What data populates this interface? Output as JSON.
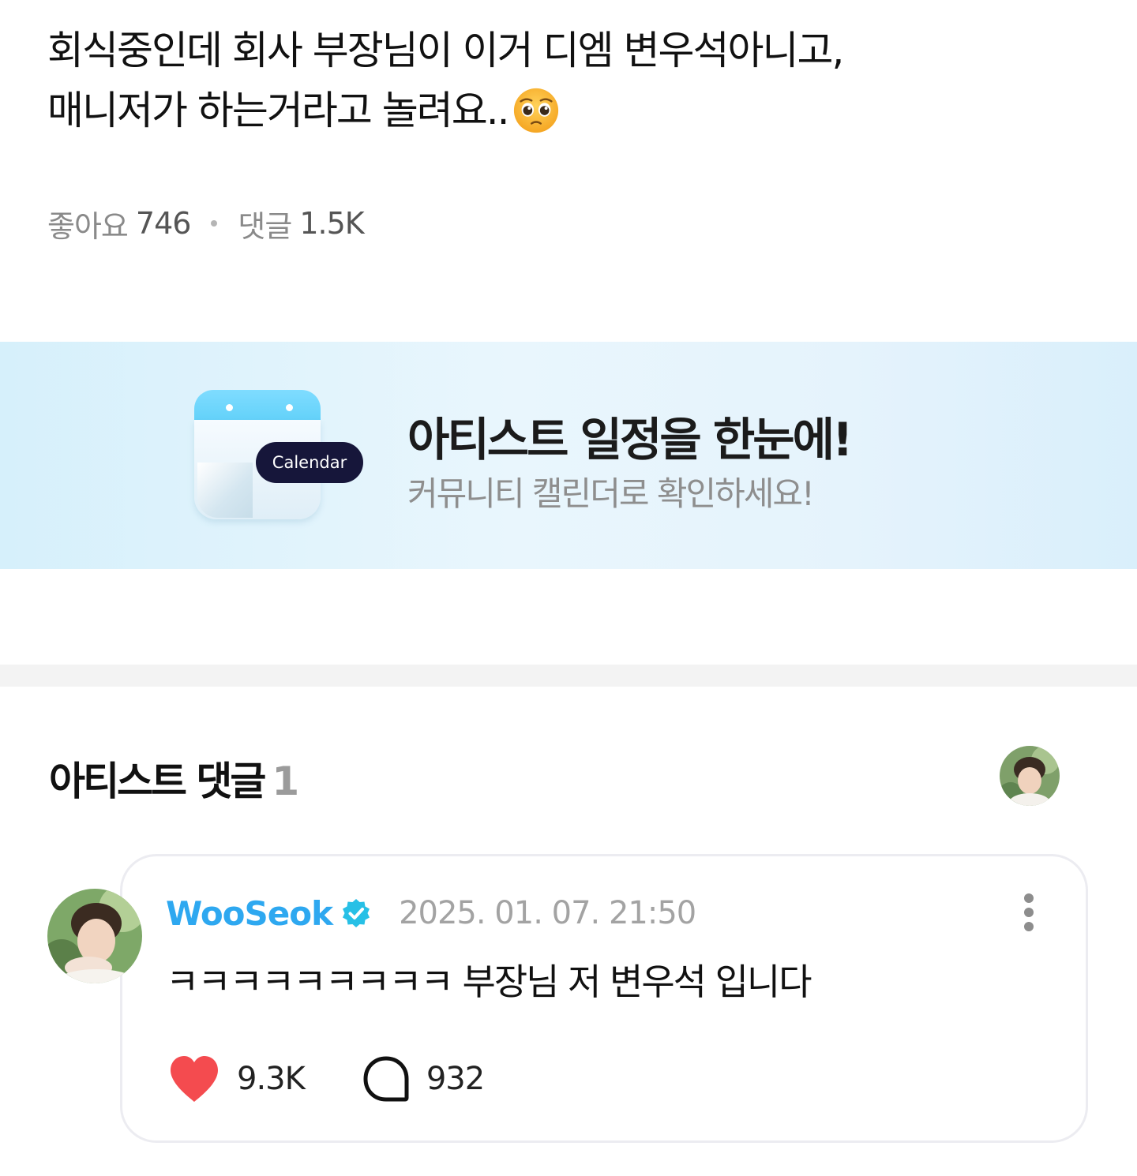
{
  "post": {
    "line1": "회식중인데 회사 부장님이 이거 디엠 변우석아니고,",
    "line2": "매니저가 하는거라고 놀려요..",
    "emoji": "pleading-face-emoji"
  },
  "stats": {
    "likes_label": "좋아요",
    "likes_count": "746",
    "comments_label": "댓글",
    "comments_count": "1.5K"
  },
  "banner": {
    "icon_label": "Calendar",
    "title": "아티스트 일정을 한눈에!",
    "subtitle": "커뮤니티 캘린더로 확인하세요!"
  },
  "artist_comments": {
    "title": "아티스트 댓글",
    "count": "1"
  },
  "comment": {
    "author": "WooSeok",
    "timestamp": "2025. 01. 07. 21:50",
    "text": "ㅋㅋㅋㅋㅋㅋㅋㅋㅋ 부장님 저 변우석 입니다",
    "likes": "9.3K",
    "replies": "932"
  },
  "colors": {
    "accent": "#2ea8f0",
    "heart": "#f44b4f",
    "banner_bg": "#e2f3fc",
    "calendar_label_bg": "#16163a",
    "divider": "#f3f3f3"
  },
  "icons": [
    "pleading-face-emoji",
    "calendar-icon",
    "artist-avatar",
    "verified-badge-icon",
    "more-vertical-icon",
    "heart-icon",
    "comment-bubble-icon"
  ]
}
